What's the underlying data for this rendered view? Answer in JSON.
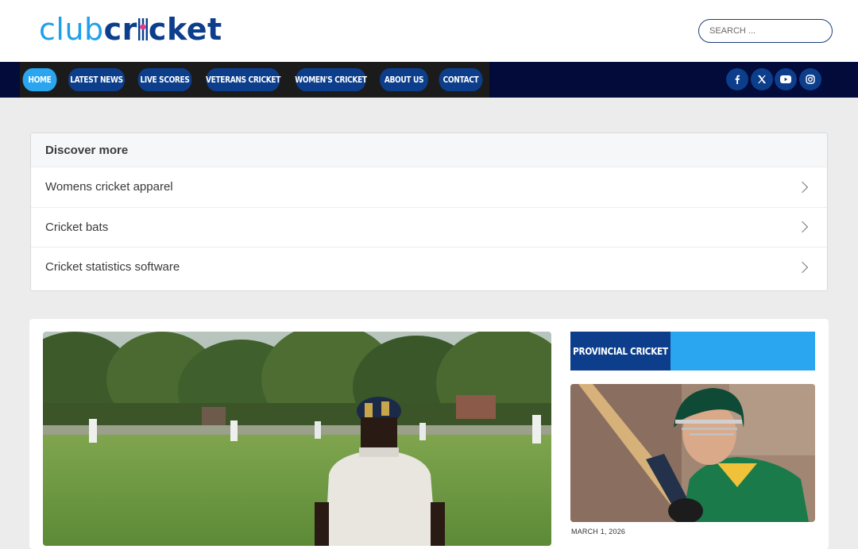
{
  "header": {
    "logo": {
      "part1": "club",
      "part2": "cr",
      "part3": "cket"
    },
    "search_placeholder": "SEARCH ..."
  },
  "nav": {
    "items": [
      {
        "label": "HOME",
        "active": true
      },
      {
        "label": "LATEST NEWS",
        "active": false
      },
      {
        "label": "LIVE SCORES",
        "active": false
      },
      {
        "label": "VETERANS CRICKET",
        "active": false
      },
      {
        "label": "WOMEN'S CRICKET",
        "active": false
      },
      {
        "label": "ABOUT US",
        "active": false
      },
      {
        "label": "CONTACT",
        "active": false
      }
    ],
    "social": [
      "facebook-icon",
      "x-icon",
      "youtube-icon",
      "instagram-icon"
    ]
  },
  "discover": {
    "title": "Discover more",
    "items": [
      {
        "label": "Womens cricket apparel"
      },
      {
        "label": "Cricket bats"
      },
      {
        "label": "Cricket statistics software"
      }
    ]
  },
  "sidebar": {
    "category": "PROVINCIAL CRICKET",
    "post_date": "MARCH 1, 2026"
  },
  "colors": {
    "brand_dark": "#0c3e8c",
    "brand_light": "#2aa6f0",
    "nav_bg": "#020b3a"
  }
}
